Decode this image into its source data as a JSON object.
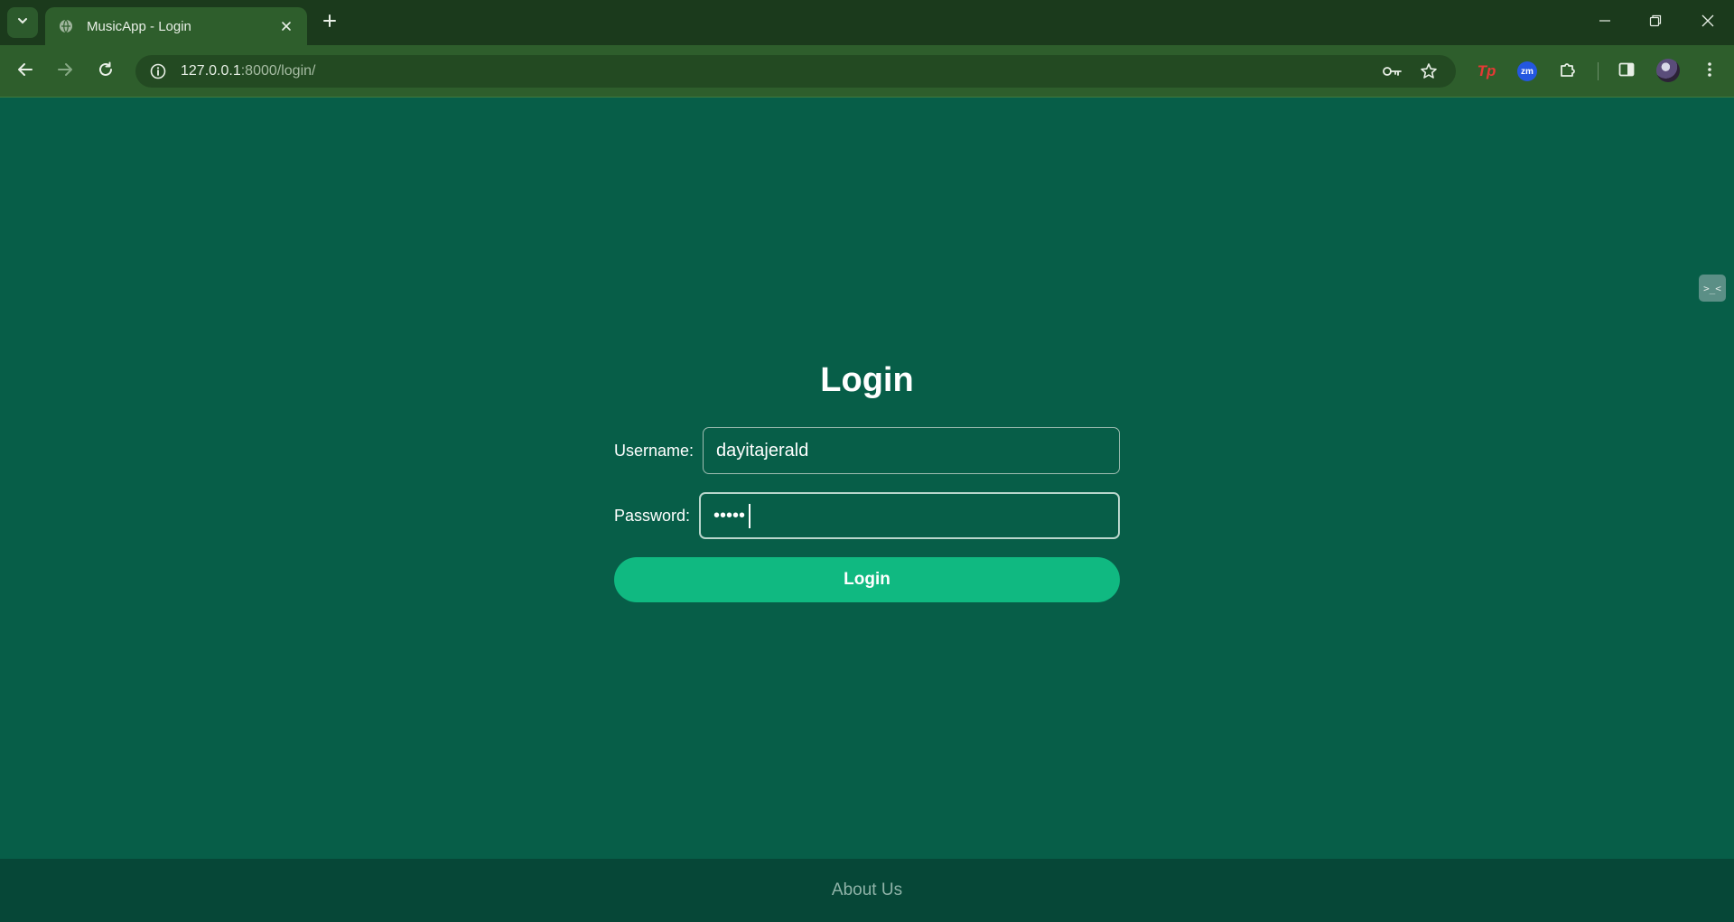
{
  "browser": {
    "tab_title": "MusicApp - Login",
    "url_host": "127.0.0.1",
    "url_path": ":8000/login/"
  },
  "icons": {
    "tab_search": "chevron-down-icon",
    "favicon": "globe-icon",
    "tab_close": "close-icon",
    "new_tab": "plus-icon",
    "back": "arrow-left-icon",
    "forward": "arrow-right-icon",
    "reload": "reload-icon",
    "site_info": "info-icon",
    "password": "key-icon",
    "bookmark": "star-icon",
    "extensions": "puzzle-icon",
    "side_panel": "side-panel-icon",
    "menu": "kebab-menu-icon"
  },
  "extensions": {
    "tp_label": "Tp",
    "zm_label": "zm"
  },
  "side_tab": {
    "label": ">_<"
  },
  "login": {
    "title": "Login",
    "username_label": "Username:",
    "username_value": "dayitajerald",
    "password_label": "Password:",
    "password_value": "•••••",
    "button_label": "Login"
  },
  "footer": {
    "link": "About Us"
  },
  "colors": {
    "page_bg": "#075e48",
    "button_bg": "#10b981",
    "footer_bg": "#064737",
    "chrome_bg": "#2e5e2c"
  }
}
